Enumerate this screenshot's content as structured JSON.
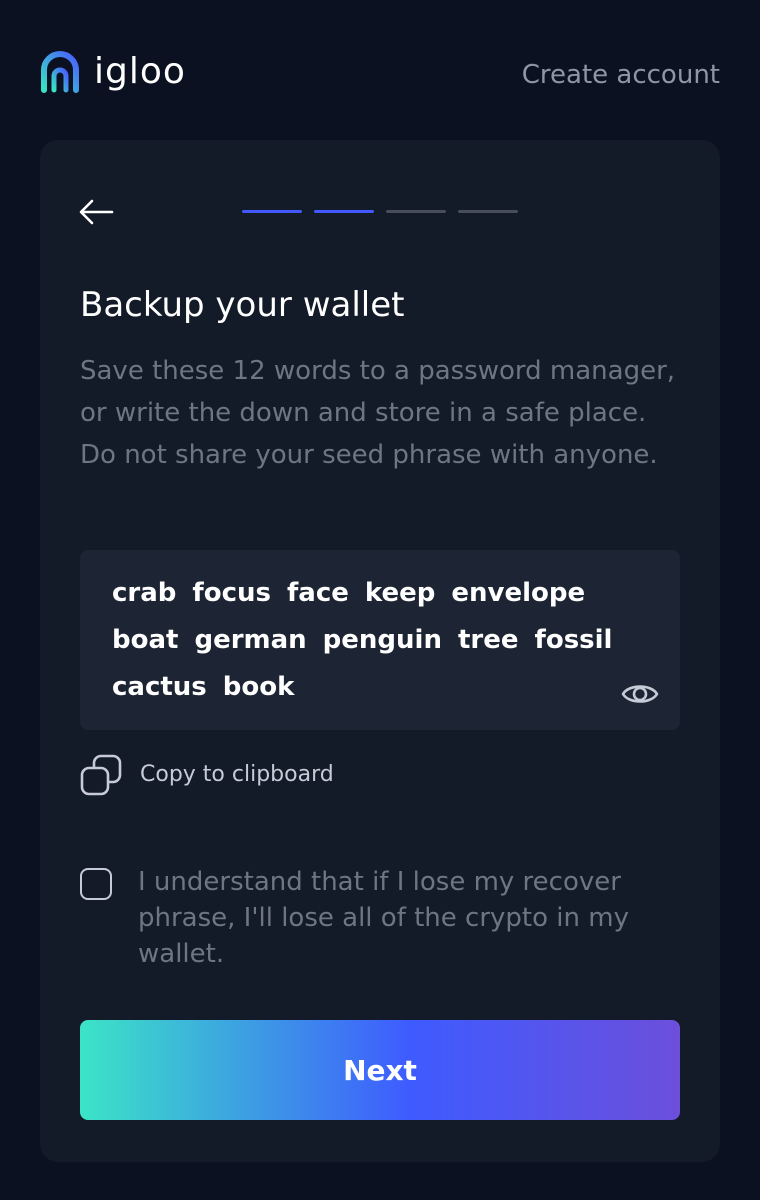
{
  "header": {
    "logo_text": "igloo",
    "create_account_label": "Create account"
  },
  "progress": {
    "total_steps": 4,
    "completed_steps": 2
  },
  "card": {
    "title": "Backup your wallet",
    "description": "Save these 12 words to a password manager, or write the down and store in a safe place. Do not share your seed phrase with anyone.",
    "seed_words": [
      "crab",
      "focus",
      "face",
      "keep",
      "envelope",
      "boat",
      "german",
      "penguin",
      "tree",
      "fossil",
      "cactus",
      "book"
    ],
    "copy_label": "Copy to clipboard",
    "consent_text": "I understand that if I lose my recover phrase, I'll lose all of the crypto in my wallet.",
    "consent_checked": false,
    "next_label": "Next"
  },
  "icons": {
    "logo": "igloo-logo-icon",
    "back": "arrow-left-icon",
    "reveal": "eye-icon",
    "copy": "copy-icon"
  },
  "colors": {
    "background": "#0b1120",
    "card": "#131a28",
    "seed_box": "#1d2433",
    "muted_text": "#6e7583",
    "progress_active": "#4159ff",
    "progress_inactive": "#474d59",
    "button_gradient_start": "#3be4c6",
    "button_gradient_mid": "#3e5bff",
    "button_gradient_end": "#6c4fdb"
  }
}
